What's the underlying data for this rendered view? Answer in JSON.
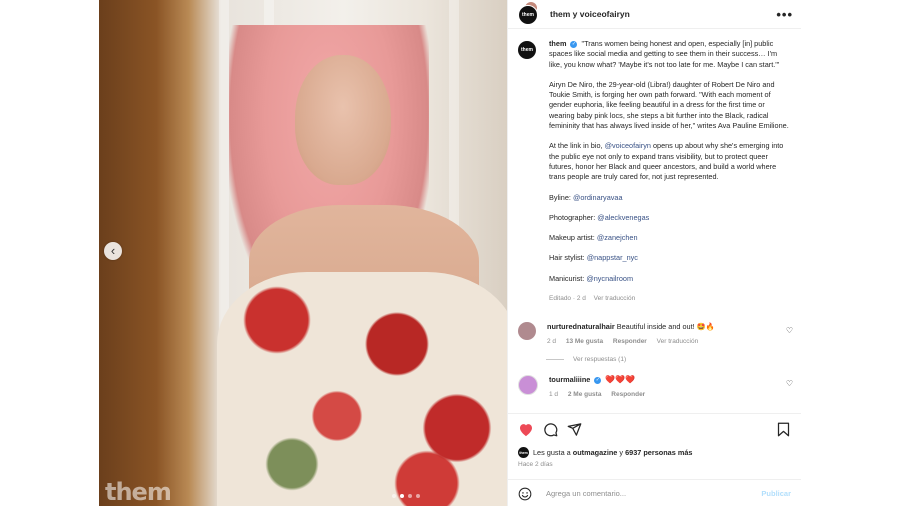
{
  "photo": {
    "watermark": "them",
    "prev_icon": "chevron-left-icon",
    "slide_count": 4,
    "active_slide": 2
  },
  "header": {
    "avatar_text": "them",
    "username": "them y voiceofairyn",
    "more_icon": "more-horizontal-icon"
  },
  "caption": {
    "avatar_text": "them",
    "username": "them",
    "verified_icon": "verified-badge-icon",
    "quote": "\"Trans women being honest and open, especially [in] public spaces like social media and getting to see them in their success… I'm like, you know what? 'Maybe it's not too late for me. Maybe I can start.'\"",
    "paragraph2": "Airyn De Niro, the 29-year-old (Libra!) daughter of Robert De Niro and Toukie Smith, is forging her own path forward. \"With each moment of gender euphoria, like feeling beautiful in a dress for the first time or wearing baby pink locs, she steps a bit further into the Black, radical femininity that has always lived inside of her,\" writes Ava Pauline Emilione.",
    "p3_before": "At the link in bio, ",
    "p3_mention": "@voiceofairyn",
    "p3_after": " opens up about why she's emerging into the public eye not only to expand trans visibility, but to protect queer futures, honor her Black and queer ancestors, and build a world where trans people are truly cared for, not just represented.",
    "credits": [
      {
        "label": "Byline: ",
        "handle": "@ordinaryavaa"
      },
      {
        "label": "Photographer: ",
        "handle": "@aleckvenegas"
      },
      {
        "label": "Makeup artist: ",
        "handle": "@zanejchen"
      },
      {
        "label": "Hair stylist: ",
        "handle": "@nappstar_nyc"
      },
      {
        "label": "Manicurist: ",
        "handle": "@nycnailroom"
      }
    ],
    "edited": "Editado · 2 d",
    "translate": "Ver traducción"
  },
  "comments": [
    {
      "username": "nurturednaturalhair",
      "text": "Beautiful inside and out! 🤩🔥",
      "time": "2 d",
      "likes": "13 Me gusta",
      "reply": "Responder",
      "translate": "Ver traducción",
      "replies": "Ver respuestas (1)",
      "avatar_color": "#b08a8f"
    },
    {
      "username": "tourmaliiine",
      "text": "❤️❤️❤️",
      "time": "1 d",
      "likes": "2 Me gusta",
      "reply": "Responder",
      "avatar_color": "#c98fd6"
    }
  ],
  "actions": {
    "like_icon": "heart-filled-icon",
    "comment_icon": "comment-icon",
    "share_icon": "send-icon",
    "save_icon": "bookmark-icon",
    "like_color": "#ed4956"
  },
  "likes": {
    "avatar_text": "outmagazine",
    "prefix": "Les gusta a ",
    "user": "outmagazine",
    "middle": " y ",
    "others": "6937 personas más"
  },
  "posted": "Hace 2 días",
  "add_comment": {
    "emoji_icon": "smiley-icon",
    "placeholder": "Agrega un comentario...",
    "publish": "Publicar"
  }
}
